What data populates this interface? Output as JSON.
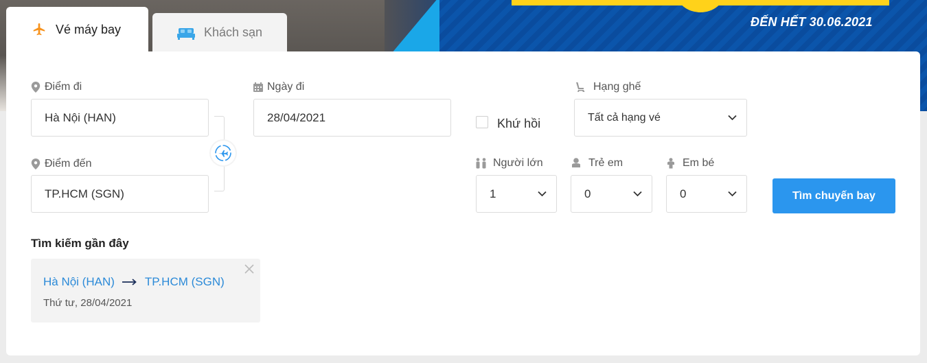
{
  "banner": {
    "promo_text": "ĐẾN HẾT 30.06.2021"
  },
  "tabs": [
    {
      "label": "Vé máy bay",
      "icon": "plane-icon",
      "active": true
    },
    {
      "label": "Khách sạn",
      "icon": "bed-icon",
      "active": false
    }
  ],
  "form": {
    "origin_label": "Điểm đi",
    "origin_value": "Hà Nội (HAN)",
    "destination_label": "Điểm đến",
    "destination_value": "TP.HCM (SGN)",
    "depart_label": "Ngày đi",
    "depart_value": "28/04/2021",
    "round_trip_label": "Khứ hồi",
    "round_trip_checked": false,
    "class_label": "Hạng ghế",
    "class_value": "Tất cả hạng vé",
    "adults_label": "Người lớn",
    "adults_value": "1",
    "children_label": "Trẻ em",
    "children_value": "0",
    "infants_label": "Em bé",
    "infants_value": "0",
    "search_button": "Tìm chuyến bay"
  },
  "recent": {
    "title": "Tìm kiếm gần đây",
    "items": [
      {
        "from": "Hà Nội (HAN)",
        "to": "TP.HCM (SGN)",
        "date": "Thứ tư, 28/04/2021"
      }
    ]
  },
  "colors": {
    "accent": "#2b96ee",
    "link": "#2b8ad8",
    "plane_orange": "#f7931e",
    "bed_blue": "#3aa6e8"
  }
}
